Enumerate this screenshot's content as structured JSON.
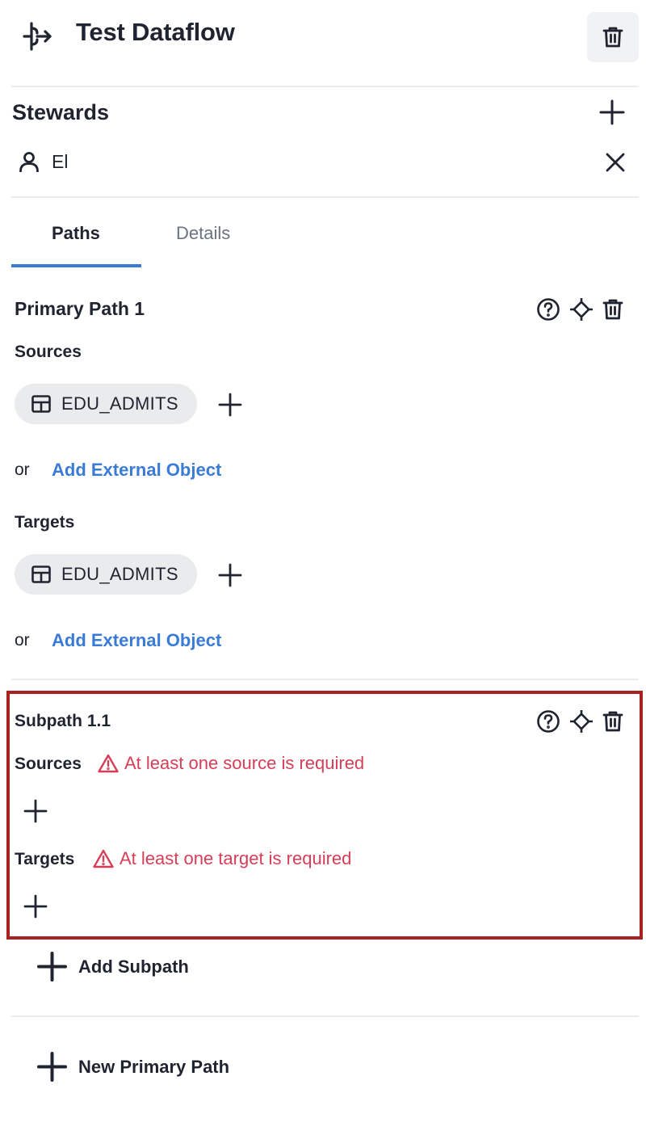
{
  "header": {
    "title": "Test Dataflow",
    "app_icon": "dataflow-icon",
    "delete_icon": "trash-icon"
  },
  "stewards": {
    "title": "Stewards",
    "items": [
      {
        "name": "El",
        "icon": "user-icon"
      }
    ]
  },
  "tabs": [
    {
      "label": "Paths",
      "active": true
    },
    {
      "label": "Details",
      "active": false
    }
  ],
  "primary_path": {
    "title": "Primary Path 1",
    "sources_label": "Sources",
    "sources": [
      {
        "name": "EDU_ADMITS",
        "icon": "table-icon"
      }
    ],
    "targets_label": "Targets",
    "targets": [
      {
        "name": "EDU_ADMITS",
        "icon": "table-icon"
      }
    ],
    "or_text": "or",
    "add_external": "Add External Object"
  },
  "subpath": {
    "title": "Subpath 1.1",
    "sources_label": "Sources",
    "sources_error": "At least one source is required",
    "targets_label": "Targets",
    "targets_error": "At least one target is required"
  },
  "actions": {
    "add_subpath": "Add Subpath",
    "new_primary_path": "New Primary Path"
  },
  "colors": {
    "accent": "#3a7bd5",
    "error": "#d63e57",
    "highlight_border": "#a92222",
    "chip_bg": "#eaebed"
  }
}
